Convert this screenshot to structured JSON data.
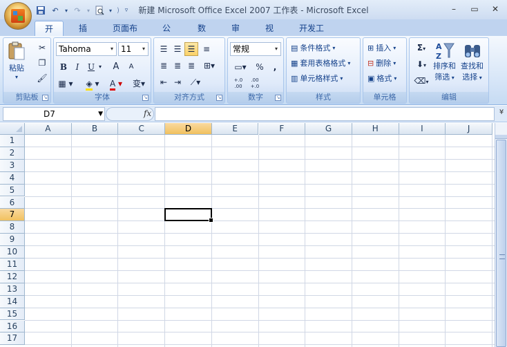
{
  "window": {
    "title": "新建 Microsoft Office Excel 2007 工作表 - Microsoft Excel"
  },
  "tabs": [
    "开始",
    "插入",
    "页面布局",
    "公式",
    "数据",
    "审阅",
    "视图",
    "开发工具"
  ],
  "active_tab": "开始",
  "clipboard": {
    "paste": "粘贴",
    "label": "剪贴板"
  },
  "font": {
    "name": "Tahoma",
    "size": "11",
    "label": "字体",
    "bold": "B",
    "italic": "I",
    "underline": "U",
    "grow": "A",
    "shrink": "A",
    "color_letter": "A",
    "wen": "变"
  },
  "alignment": {
    "label": "对齐方式"
  },
  "number": {
    "format": "常规",
    "label": "数字",
    "percent": "%",
    "comma": ",",
    "inc": "+.0 .00",
    "dec": ".00 +.0"
  },
  "styles": {
    "conditional": "条件格式",
    "table": "套用表格格式",
    "cell": "单元格样式",
    "label": "样式"
  },
  "cells": {
    "insert": "插入",
    "delete": "删除",
    "format": "格式",
    "label": "单元格"
  },
  "editing": {
    "sort": "排序和",
    "sort2": "筛选",
    "find": "查找和",
    "find2": "选择",
    "sigma": "Σ",
    "label": "编辑"
  },
  "namebox": "D7",
  "fx": "fx",
  "columns": [
    "A",
    "B",
    "C",
    "D",
    "E",
    "F",
    "G",
    "H",
    "I",
    "J"
  ],
  "rows": [
    "1",
    "2",
    "3",
    "4",
    "5",
    "6",
    "7",
    "8",
    "9",
    "10",
    "11",
    "12",
    "13",
    "14",
    "15",
    "16",
    "17"
  ],
  "selected": {
    "col": "D",
    "row": "7"
  },
  "colors": {
    "accent": "#15428b",
    "selection": "#f1c15f"
  }
}
